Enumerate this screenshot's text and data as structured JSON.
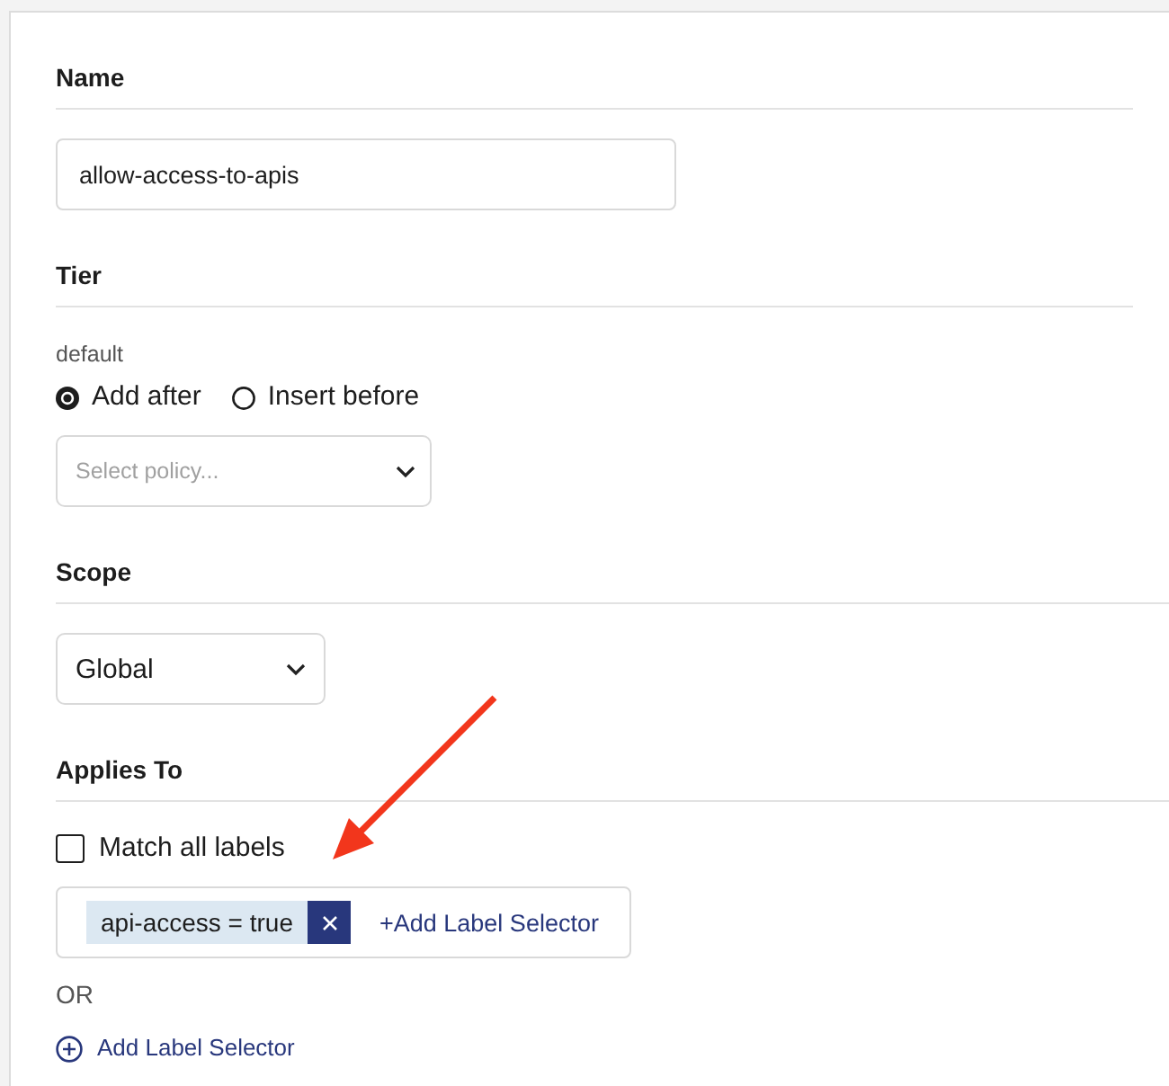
{
  "sections": [
    {
      "kind": "text_input",
      "heading": "Name",
      "input": {
        "value": "allow-access-to-apis"
      }
    },
    {
      "kind": "tier",
      "heading": "Tier",
      "tier_name": "default",
      "placement": [
        {
          "label": "Add after",
          "selected": true
        },
        {
          "label": "Insert before",
          "selected": false
        }
      ],
      "policy_select": {
        "placeholder": "Select policy..."
      }
    },
    {
      "kind": "select",
      "heading": "Scope",
      "select": {
        "value": "Global"
      }
    },
    {
      "kind": "applies_to",
      "heading": "Applies To",
      "match_all": {
        "label": "Match all labels",
        "checked": false
      },
      "selector_field": {
        "chips": [
          {
            "label": "api-access = true"
          }
        ],
        "add_link": "+Add Label Selector"
      },
      "separator": "OR",
      "add_link": "Add Label Selector"
    }
  ]
}
